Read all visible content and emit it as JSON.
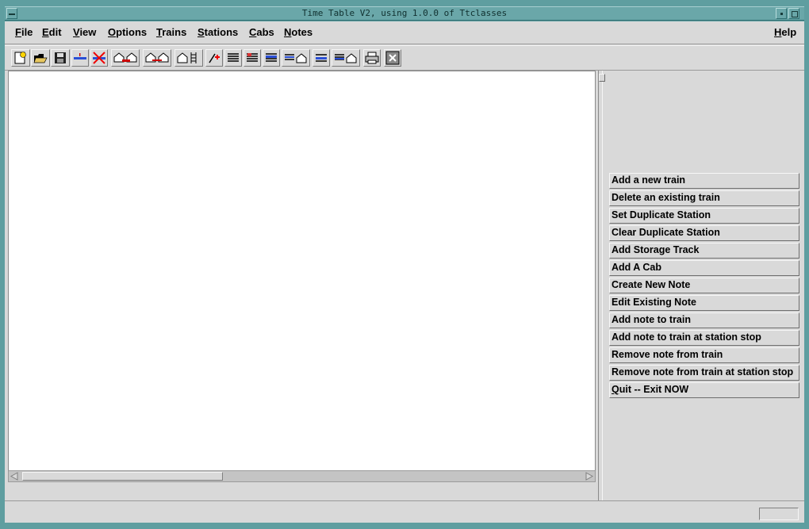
{
  "window": {
    "title": "Time Table V2, using 1.0.0  of Ttclasses"
  },
  "menubar": {
    "items": [
      "File",
      "Edit",
      "View",
      "Options",
      "Trains",
      "Stations",
      "Cabs",
      "Notes"
    ],
    "help": "Help"
  },
  "toolbar": {
    "icons": [
      "new-file-icon",
      "open-folder-icon",
      "save-disk-icon",
      "add-train-icon",
      "delete-train-icon",
      "stations-icon",
      "duplicate-station-icon",
      "storage-track-icon",
      "add-cab-icon",
      "list-icon",
      "notes-list-icon",
      "edit-note-icon",
      "note-train-icon",
      "note-station-icon",
      "remove-note-icon",
      "remove-station-note-icon",
      "print-icon",
      "exit-icon"
    ]
  },
  "commands": [
    "Add a new train",
    "Delete an existing train",
    "Set Duplicate Station",
    "Clear Duplicate Station",
    "Add Storage Track",
    "Add A Cab",
    "Create New Note",
    "Edit Existing Note",
    "Add note to train",
    "Add note to train at station stop",
    "Remove note from train",
    "Remove note from train at station stop",
    "Quit -- Exit NOW"
  ],
  "status": {
    "text": ""
  },
  "colors": {
    "titlebar": "#6aa7a9",
    "frame": "#5f9ea0",
    "panel": "#d9d9d9"
  }
}
